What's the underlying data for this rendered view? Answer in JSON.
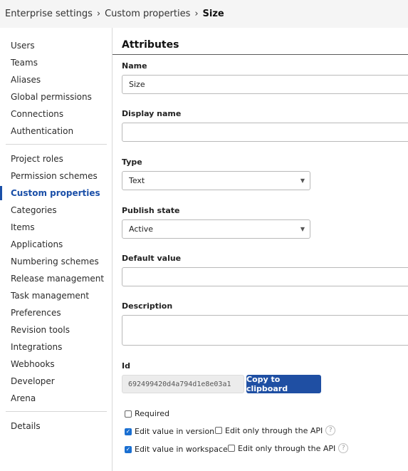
{
  "breadcrumb": {
    "items": [
      "Enterprise settings",
      "Custom properties"
    ],
    "current": "Size",
    "separator_icon": "chevron-right-icon"
  },
  "sidebar": {
    "group1": [
      "Users",
      "Teams",
      "Aliases",
      "Global permissions",
      "Connections",
      "Authentication"
    ],
    "group2": [
      "Project roles",
      "Permission schemes",
      "Custom properties",
      "Categories",
      "Items",
      "Applications",
      "Numbering schemes",
      "Release management",
      "Task management",
      "Preferences",
      "Revision tools",
      "Integrations",
      "Webhooks",
      "Developer",
      "Arena"
    ],
    "group3": [
      "Details"
    ],
    "active": "Custom properties",
    "active_color": "#1a4fa8"
  },
  "form": {
    "title": "Attributes",
    "name": {
      "label": "Name",
      "value": "Size"
    },
    "display_name": {
      "label": "Display name",
      "value": ""
    },
    "type": {
      "label": "Type",
      "value": "Text"
    },
    "publish_state": {
      "label": "Publish state",
      "value": "Active"
    },
    "default_value": {
      "label": "Default value",
      "value": ""
    },
    "description": {
      "label": "Description",
      "value": ""
    },
    "id": {
      "label": "Id",
      "value": "692499420d4a794d1e8e03a1",
      "copy_label": "Copy to clipboard"
    },
    "required": {
      "label": "Required",
      "checked": false
    },
    "edit_in_version": {
      "label": "Edit value in version",
      "checked": true,
      "api_label": "Edit only through the API",
      "api_checked": false
    },
    "edit_in_workspace": {
      "label": "Edit value in workspace",
      "checked": true,
      "api_label": "Edit only through the API",
      "api_checked": false
    },
    "help_icon": "question-circle-icon",
    "button_color": "#1f4fa3"
  }
}
